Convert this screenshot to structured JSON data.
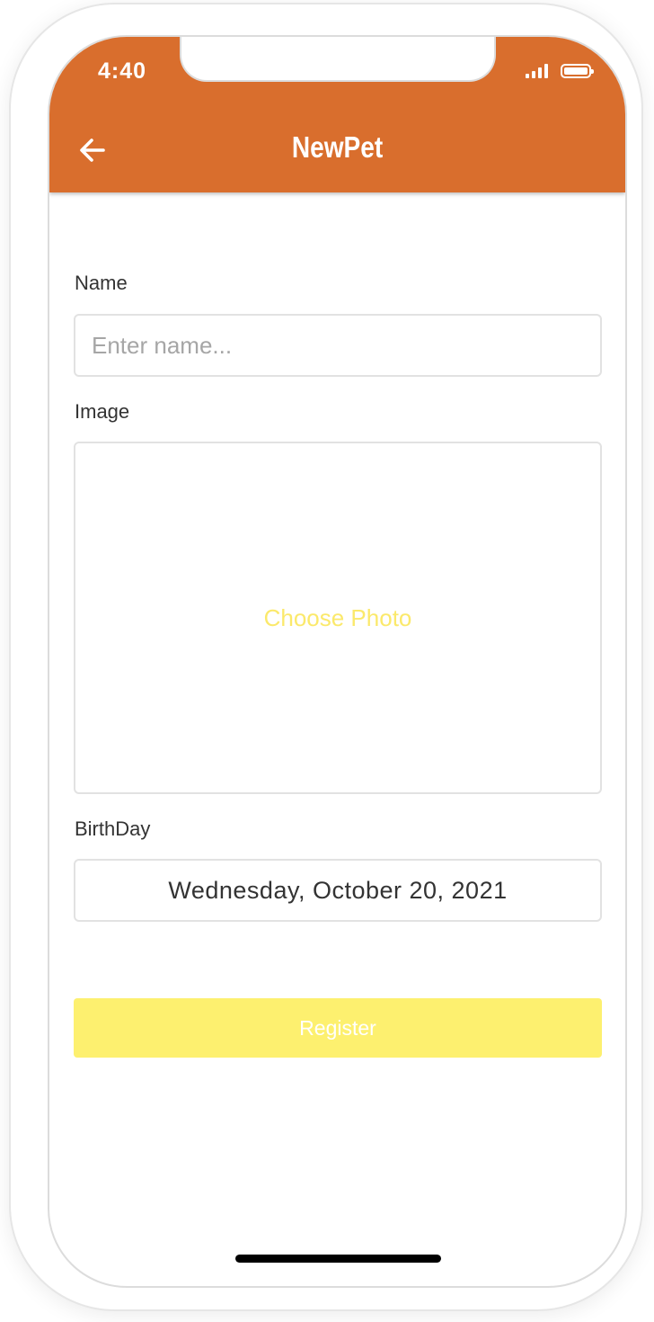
{
  "status_bar": {
    "time": "4:40"
  },
  "header": {
    "title": "NewPet",
    "back_icon": "arrow-left-icon"
  },
  "form": {
    "name": {
      "label": "Name",
      "placeholder": "Enter name...",
      "value": ""
    },
    "image": {
      "label": "Image",
      "choose_label": "Choose Photo"
    },
    "birthday": {
      "label": "BirthDay",
      "value": "Wednesday, October 20, 2021"
    },
    "register_label": "Register"
  },
  "colors": {
    "accent": "#d96e2d",
    "button": "#fdf06f",
    "choose_photo_text": "#fbe96b"
  }
}
